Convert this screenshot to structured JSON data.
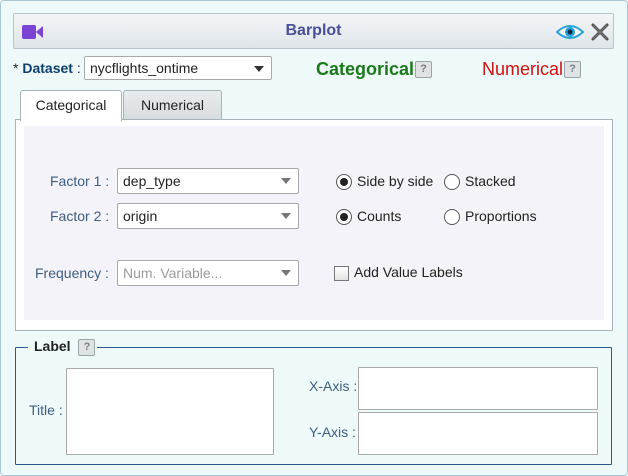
{
  "window": {
    "title": "Barplot"
  },
  "dataset": {
    "required_mark": "*",
    "label": "Dataset",
    "separator": ":",
    "selected": "nycflights_ontime"
  },
  "header_links": {
    "categorical": "Categorical",
    "numerical": "Numerical",
    "help_glyph": "?"
  },
  "tabs": [
    {
      "label": "Categorical",
      "active": true
    },
    {
      "label": "Numerical",
      "active": false
    }
  ],
  "categorical": {
    "factor1": {
      "label": "Factor 1 :",
      "selected": "dep_type"
    },
    "factor2": {
      "label": "Factor 2 :",
      "selected": "origin"
    },
    "frequency": {
      "label": "Frequency :",
      "placeholder": "Num. Variable..."
    },
    "layout_options": [
      {
        "label": "Side by side",
        "checked": true
      },
      {
        "label": "Stacked",
        "checked": false
      }
    ],
    "scale_options": [
      {
        "label": "Counts",
        "checked": true
      },
      {
        "label": "Proportions",
        "checked": false
      }
    ],
    "value_labels": {
      "label": "Add Value Labels",
      "checked": false
    }
  },
  "label_section": {
    "legend": "Label",
    "title_label": "Title :",
    "xaxis_label": "X-Axis :",
    "yaxis_label": "Y-Axis :",
    "title_value": "",
    "xaxis_value": "",
    "yaxis_value": ""
  },
  "colors": {
    "title": "#4a4f9a",
    "categorical": "#1a7a1a",
    "numerical": "#d01010",
    "field_label": "#3c5e83",
    "panel_bg": "#eefaf9"
  },
  "icons": {
    "window": "video-camera-icon",
    "preview": "eye-icon",
    "close": "close-icon"
  }
}
